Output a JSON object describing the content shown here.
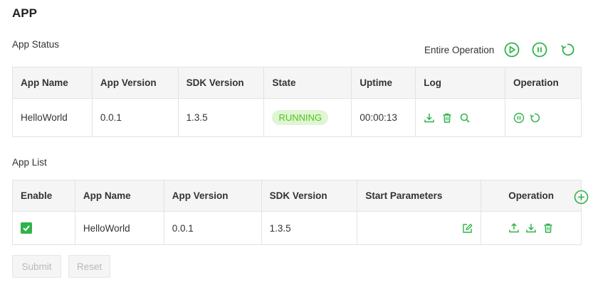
{
  "page": {
    "title": "APP"
  },
  "colors": {
    "accent": "#2fb34a",
    "running_bg": "#dff5d4",
    "running_text": "#52c41a",
    "header_bg": "#f5f5f5",
    "border": "#e3e3e3"
  },
  "status": {
    "title": "App Status",
    "entire_operation": {
      "label": "Entire Operation",
      "icons": [
        "play-circle-icon",
        "pause-circle-icon",
        "restart-icon"
      ]
    },
    "columns": [
      "App Name",
      "App Version",
      "SDK Version",
      "State",
      "Uptime",
      "Log",
      "Operation"
    ],
    "rows": [
      {
        "app_name": "HelloWorld",
        "app_version": "0.0.1",
        "sdk_version": "1.3.5",
        "state": "RUNNING",
        "uptime": "00:00:13",
        "log_icons": [
          "download-icon",
          "trash-icon",
          "search-icon"
        ],
        "operation_icons": [
          "pause-circle-icon",
          "restart-icon"
        ]
      }
    ]
  },
  "list": {
    "title": "App List",
    "columns": [
      "Enable",
      "App Name",
      "App Version",
      "SDK Version",
      "Start Parameters",
      "Operation"
    ],
    "add_icon": "plus-circle-icon",
    "rows": [
      {
        "enabled": true,
        "app_name": "HelloWorld",
        "app_version": "0.0.1",
        "sdk_version": "1.3.5",
        "start_parameters": "",
        "edit_icon": "edit-icon",
        "operation_icons": [
          "upload-icon",
          "download-icon",
          "trash-icon"
        ]
      }
    ]
  },
  "actions": {
    "submit_label": "Submit",
    "reset_label": "Reset"
  }
}
